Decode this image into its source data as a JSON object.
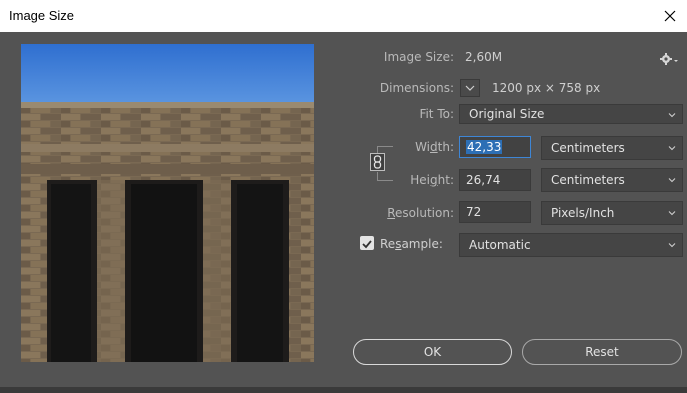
{
  "dialog": {
    "title": "Image Size",
    "close_symbol": "×"
  },
  "info": {
    "image_size_label": "Image Size:",
    "image_size_value": "2,60M",
    "dimensions_label": "Dimensions:",
    "dimensions_value": "1200 px  ×  758 px"
  },
  "fit_to": {
    "label": "Fit To:",
    "value": "Original Size"
  },
  "width": {
    "label_pre": "Wi",
    "label_u": "d",
    "label_post": "th:",
    "value": "42,33",
    "unit": "Centimeters"
  },
  "height": {
    "label_pre": "Hei",
    "label_u": "g",
    "label_post": "ht:",
    "value": "26,74",
    "unit": "Centimeters"
  },
  "resolution": {
    "label_u": "R",
    "label_post": "esolution:",
    "value": "72",
    "unit": "Pixels/Inch"
  },
  "resample": {
    "label_pre": "Re",
    "label_u": "s",
    "label_post": "ample:",
    "checked": true,
    "value": "Automatic"
  },
  "buttons": {
    "ok": "OK",
    "reset": "Reset"
  },
  "icons": {
    "gear": "gear-icon",
    "link": "chain-link-icon",
    "close": "close-icon",
    "checkmark": "checkmark-icon",
    "chevron": "chevron-down-icon"
  },
  "colors": {
    "panel": "#535353",
    "focus": "#3e86d6",
    "selection": "#2d6fb5",
    "sky": "#3a7ad6"
  }
}
